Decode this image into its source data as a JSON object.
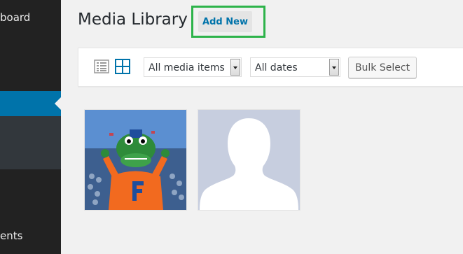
{
  "sidebar": {
    "dashboard_label": "board",
    "comments_label": "ents"
  },
  "header": {
    "title": "Media Library",
    "add_new_label": "Add New"
  },
  "toolbar": {
    "filter_type": {
      "selected": "All media items"
    },
    "filter_date": {
      "selected": "All dates"
    },
    "bulk_select_label": "Bulk Select",
    "list_view_icon": "list-icon",
    "grid_view_icon": "grid-icon"
  },
  "media": [
    {
      "kind": "photo",
      "subject": "gator-mascot"
    },
    {
      "kind": "placeholder",
      "subject": "default-avatar"
    }
  ],
  "colors": {
    "sidebar_bg": "#222222",
    "active_menu": "#0073aa",
    "highlight": "#2db34a",
    "link": "#0073aa"
  }
}
